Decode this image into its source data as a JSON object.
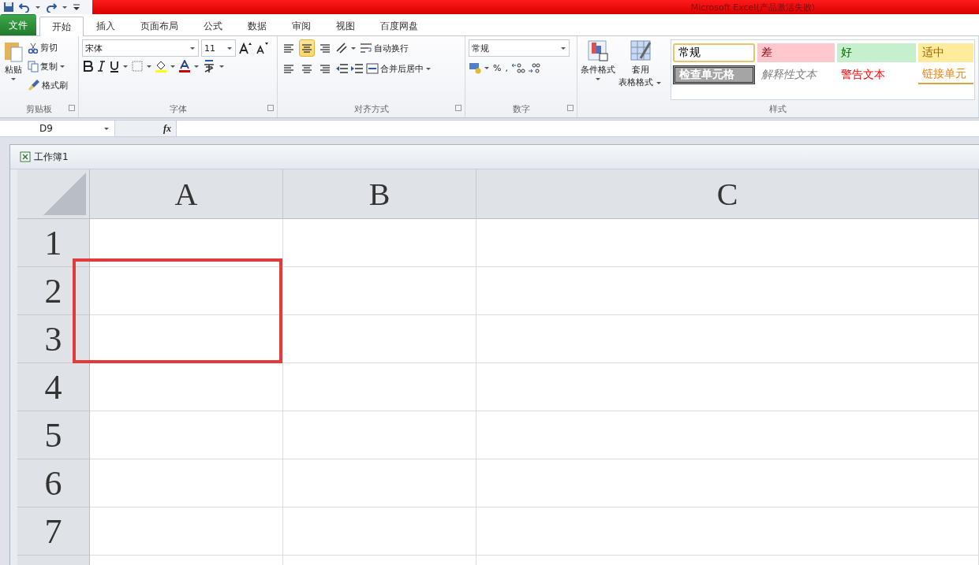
{
  "title_bar": {
    "title": "Microsoft Excel(产品激活失败)"
  },
  "tabs": [
    {
      "label": "文件",
      "kind": "file",
      "selected": false
    },
    {
      "label": "开始",
      "kind": "tab",
      "selected": true
    },
    {
      "label": "插入",
      "kind": "tab",
      "selected": false
    },
    {
      "label": "页面布局",
      "kind": "tab",
      "selected": false
    },
    {
      "label": "公式",
      "kind": "tab",
      "selected": false
    },
    {
      "label": "数据",
      "kind": "tab",
      "selected": false
    },
    {
      "label": "审阅",
      "kind": "tab",
      "selected": false
    },
    {
      "label": "视图",
      "kind": "tab",
      "selected": false
    },
    {
      "label": "百度网盘",
      "kind": "tab",
      "selected": false
    }
  ],
  "ribbon": {
    "clipboard": {
      "paste": "粘贴",
      "cut": "剪切",
      "copy": "复制",
      "format_painter": "格式刷",
      "label": "剪贴板"
    },
    "font": {
      "name": "宋体",
      "size": "11",
      "label": "字体"
    },
    "alignment": {
      "vertical": [
        {
          "selected": false
        },
        {
          "selected": true
        },
        {
          "selected": false
        }
      ],
      "wrap": "自动换行",
      "merge": "合并后居中",
      "label": "对齐方式"
    },
    "number": {
      "format": "常规",
      "percent": "%",
      "comma": ",",
      "label": "数字"
    },
    "styles": {
      "conditional": "条件格式",
      "table_format": [
        "套用",
        "表格格式"
      ],
      "label": "样式",
      "cells": [
        {
          "label": "常规",
          "kind": "normal",
          "selected": true
        },
        {
          "label": "差",
          "kind": "bad",
          "selected": false
        },
        {
          "label": "好",
          "kind": "good",
          "selected": false
        },
        {
          "label": "适中",
          "kind": "neutral",
          "selected": false
        },
        {
          "label": "检查单元格",
          "kind": "check",
          "selected": false
        },
        {
          "label": "解释性文本",
          "kind": "explanatory",
          "selected": false
        },
        {
          "label": "警告文本",
          "kind": "warning",
          "selected": false
        },
        {
          "label": "链接单元",
          "kind": "linked",
          "selected": false
        }
      ]
    }
  },
  "formula_bar": {
    "name_box": "D9",
    "fx": "fx"
  },
  "workbook": {
    "title": "工作簿1",
    "columns": [
      "A",
      "B",
      "C"
    ],
    "rows": [
      {
        "label": "1",
        "marked": false
      },
      {
        "label": "2",
        "marked": true
      },
      {
        "label": "3",
        "marked": true
      },
      {
        "label": "4",
        "marked": false
      },
      {
        "label": "5",
        "marked": false
      },
      {
        "label": "6",
        "marked": false
      },
      {
        "label": "7",
        "marked": false
      }
    ]
  }
}
